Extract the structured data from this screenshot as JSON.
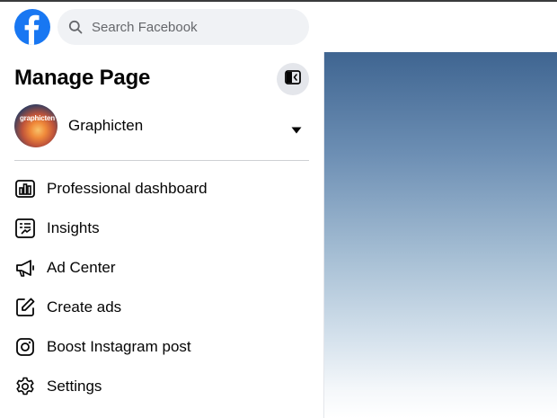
{
  "header": {
    "logo": "facebook-logo",
    "search": {
      "placeholder": "Search Facebook",
      "value": ""
    }
  },
  "panel": {
    "title": "Manage Page",
    "collapse_icon": "sidebar-collapse-icon",
    "page": {
      "name": "Graphicten",
      "avatar_text": "graphicten"
    },
    "menu": [
      {
        "label": "Professional dashboard",
        "icon": "dashboard-icon"
      },
      {
        "label": "Insights",
        "icon": "insights-icon"
      },
      {
        "label": "Ad Center",
        "icon": "megaphone-icon"
      },
      {
        "label": "Create ads",
        "icon": "pencil-edit-icon"
      },
      {
        "label": "Boost Instagram post",
        "icon": "instagram-icon"
      },
      {
        "label": "Settings",
        "icon": "gear-icon"
      }
    ]
  },
  "colors": {
    "brand": "#1877f2",
    "search_bg": "#f0f2f5",
    "text": "#050505",
    "muted": "#65676b"
  }
}
